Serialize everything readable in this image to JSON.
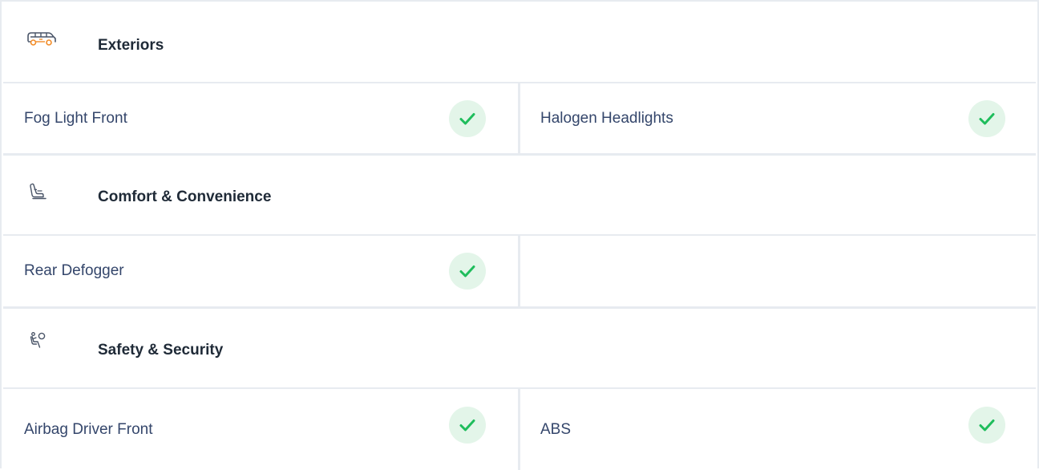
{
  "sections": [
    {
      "title": "Exteriors",
      "icon": "car-icon",
      "features": [
        {
          "label": "Fog Light Front",
          "available": true
        },
        {
          "label": "Halogen Headlights",
          "available": true
        }
      ]
    },
    {
      "title": "Comfort & Convenience",
      "icon": "car-seat-icon",
      "features": [
        {
          "label": "Rear Defogger",
          "available": true
        }
      ]
    },
    {
      "title": "Safety & Security",
      "icon": "airbag-icon",
      "features": [
        {
          "label": "Airbag Driver Front",
          "available": true
        },
        {
          "label": "ABS",
          "available": true
        }
      ]
    }
  ],
  "colors": {
    "accent_orange": "#f28c28",
    "check_green": "#1fbd5c",
    "check_bg": "#e3f5e9",
    "border": "#e7ebf0"
  }
}
